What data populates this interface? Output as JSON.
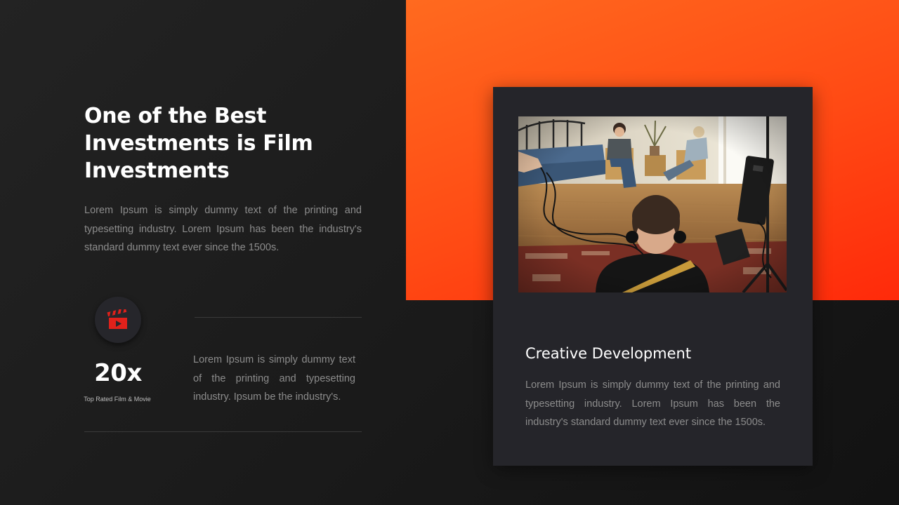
{
  "slide": {
    "title": "One of the Best Investments is Film Investments",
    "intro": "Lorem Ipsum is simply dummy text of the printing and typesetting industry.  Lorem Ipsum has been the industry's standard dummy text ever since the 1500s."
  },
  "stat": {
    "icon": "clapperboard-icon",
    "value": "20x",
    "label": "Top Rated Film & Movie",
    "description": "Lorem Ipsum is simply dummy text of the printing and typesetting industry. Ipsum be the industry's."
  },
  "card": {
    "title": "Creative Development",
    "text": "Lorem Ipsum is simply dummy text of the printing and typesetting industry.  Lorem Ipsum has been the industry's standard dummy text ever since the 1500s."
  },
  "colors": {
    "accent": "#ff4a14",
    "icon": "#e0211b",
    "background": "#1c1c1c",
    "card": "#25252a"
  }
}
